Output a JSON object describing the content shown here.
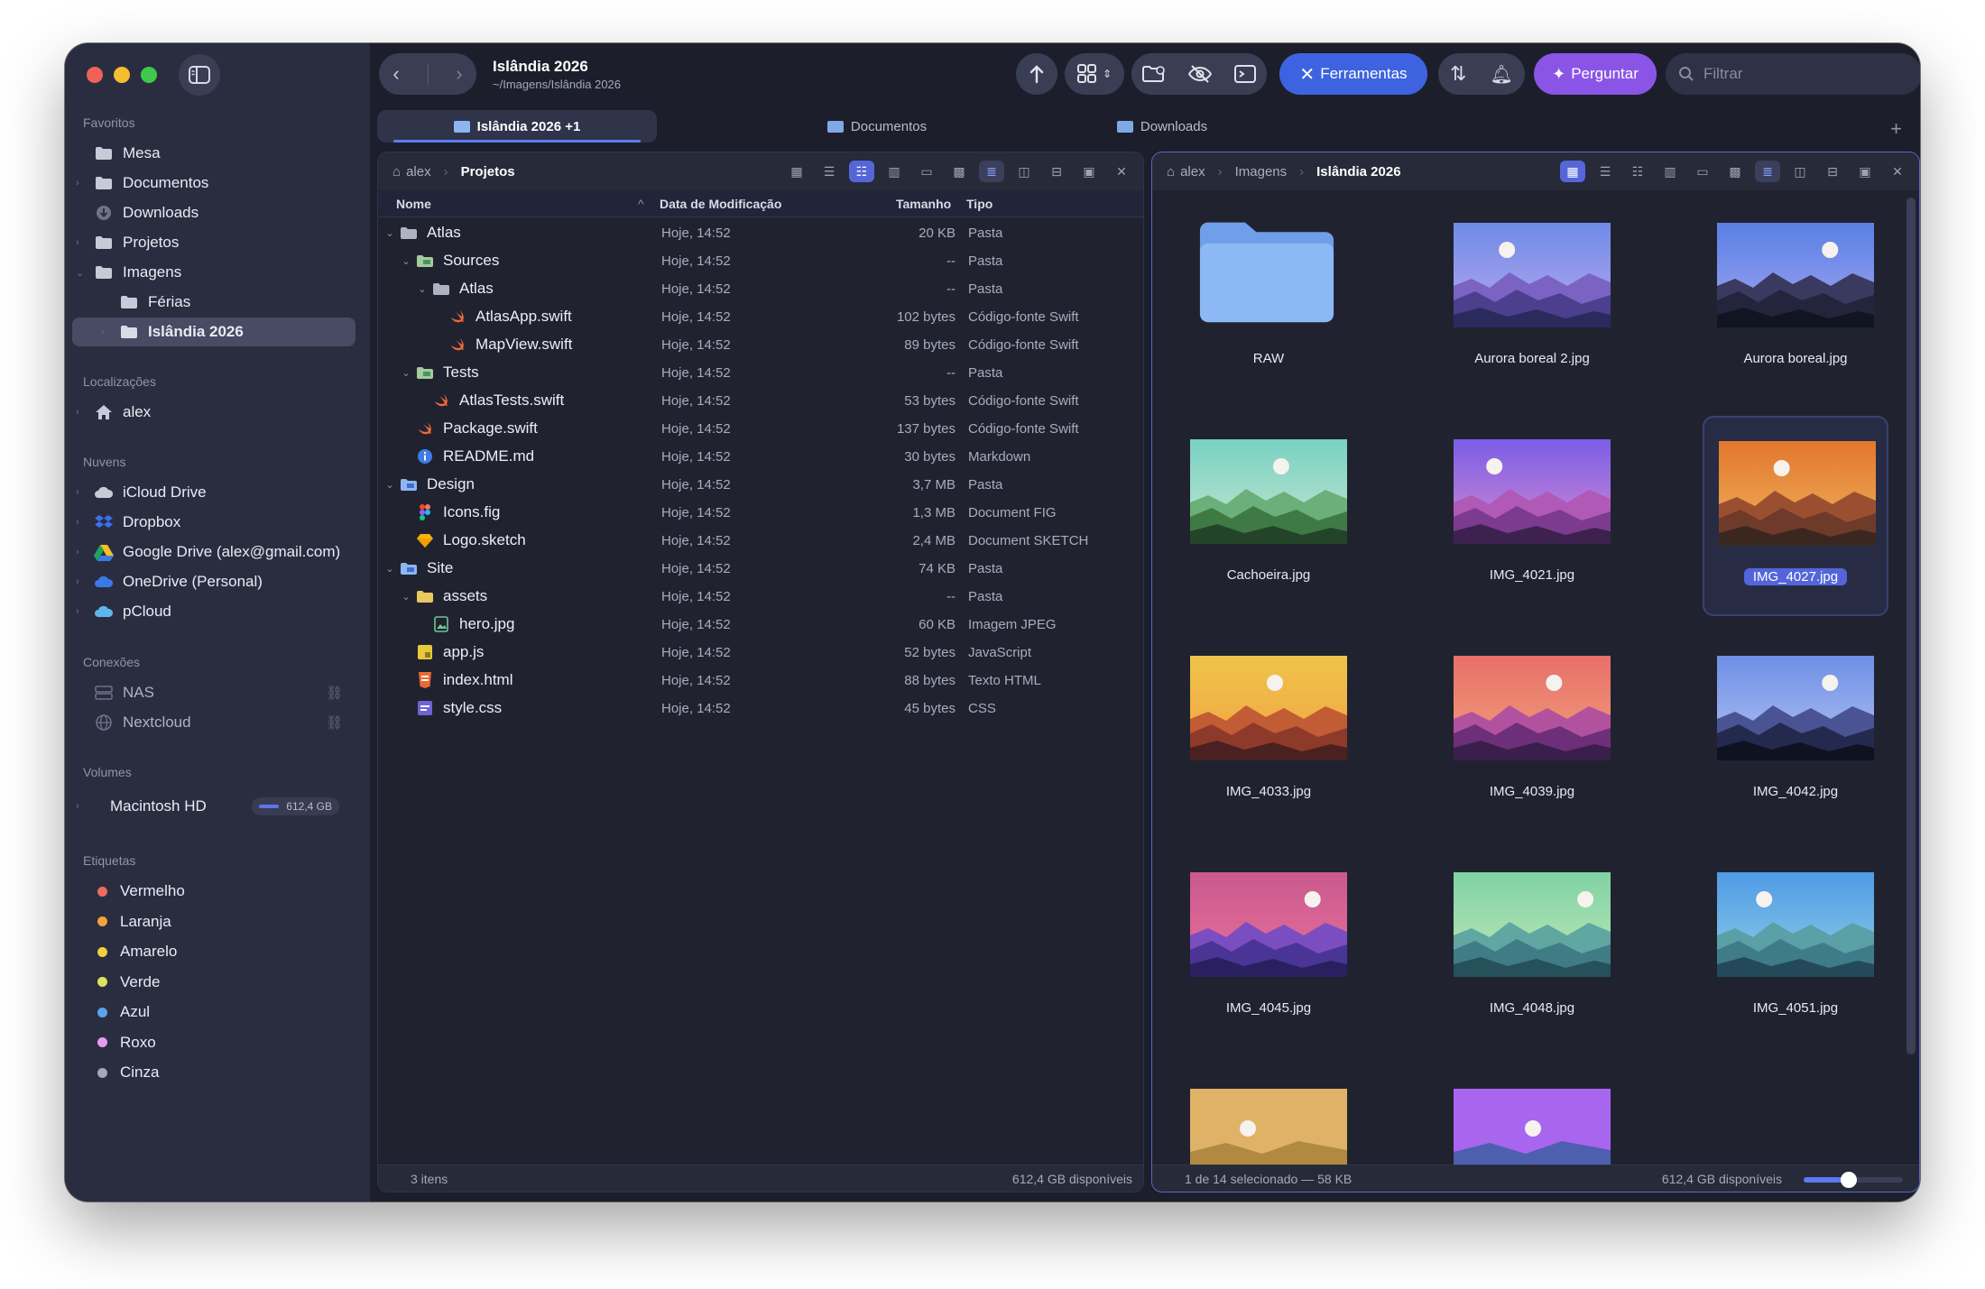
{
  "sidebar": {
    "sections": {
      "favorites": "Favoritos",
      "locations": "Localizações",
      "clouds": "Nuvens",
      "connections": "Conexões",
      "volumes": "Volumes",
      "tags": "Etiquetas"
    },
    "favorites": [
      "Mesa",
      "Documentos",
      "Downloads",
      "Projetos",
      "Imagens",
      "Férias",
      "Islândia 2026"
    ],
    "locations": [
      "alex"
    ],
    "clouds": [
      "iCloud Drive",
      "Dropbox",
      "Google Drive (alex@gmail.com)",
      "OneDrive (Personal)",
      "pCloud"
    ],
    "connections": [
      "NAS",
      "Nextcloud"
    ],
    "volume": {
      "name": "Macintosh HD",
      "free": "612,4 GB"
    },
    "tags": [
      {
        "name": "Vermelho",
        "color": "#ef6a5f"
      },
      {
        "name": "Laranja",
        "color": "#f2a33a"
      },
      {
        "name": "Amarelo",
        "color": "#f2cf3b"
      },
      {
        "name": "Verde",
        "color": "#dbe35b"
      },
      {
        "name": "Azul",
        "color": "#5aa4ee"
      },
      {
        "name": "Roxo",
        "color": "#e49cf0"
      },
      {
        "name": "Cinza",
        "color": "#a4a7b4"
      }
    ]
  },
  "toolbar": {
    "title": "Islândia 2026",
    "path": "~/Imagens/Islândia 2026",
    "tools_label": "Ferramentas",
    "ask_label": "Perguntar",
    "filter_placeholder": "Filtrar"
  },
  "tabs": [
    "Islândia 2026  +1",
    "Documentos",
    "Downloads"
  ],
  "left_pane": {
    "breadcrumb": [
      "alex",
      "Projetos"
    ],
    "columns": {
      "name": "Nome",
      "date": "Data de Modificação",
      "size": "Tamanho",
      "kind": "Tipo"
    },
    "rows": [
      {
        "name": "Atlas",
        "date": "Hoje, 14:52",
        "size": "20 KB",
        "kind": "Pasta"
      },
      {
        "name": "Sources",
        "date": "Hoje, 14:52",
        "size": "--",
        "kind": "Pasta"
      },
      {
        "name": "Atlas",
        "date": "Hoje, 14:52",
        "size": "--",
        "kind": "Pasta"
      },
      {
        "name": "AtlasApp.swift",
        "date": "Hoje, 14:52",
        "size": "102 bytes",
        "kind": "Código-fonte Swift"
      },
      {
        "name": "MapView.swift",
        "date": "Hoje, 14:52",
        "size": "89 bytes",
        "kind": "Código-fonte Swift"
      },
      {
        "name": "Tests",
        "date": "Hoje, 14:52",
        "size": "--",
        "kind": "Pasta"
      },
      {
        "name": "AtlasTests.swift",
        "date": "Hoje, 14:52",
        "size": "53 bytes",
        "kind": "Código-fonte Swift"
      },
      {
        "name": "Package.swift",
        "date": "Hoje, 14:52",
        "size": "137 bytes",
        "kind": "Código-fonte Swift"
      },
      {
        "name": "README.md",
        "date": "Hoje, 14:52",
        "size": "30 bytes",
        "kind": "Markdown"
      },
      {
        "name": "Design",
        "date": "Hoje, 14:52",
        "size": "3,7 MB",
        "kind": "Pasta"
      },
      {
        "name": "Icons.fig",
        "date": "Hoje, 14:52",
        "size": "1,3 MB",
        "kind": "Document FIG"
      },
      {
        "name": "Logo.sketch",
        "date": "Hoje, 14:52",
        "size": "2,4 MB",
        "kind": "Document SKETCH"
      },
      {
        "name": "Site",
        "date": "Hoje, 14:52",
        "size": "74 KB",
        "kind": "Pasta"
      },
      {
        "name": "assets",
        "date": "Hoje, 14:52",
        "size": "--",
        "kind": "Pasta"
      },
      {
        "name": "hero.jpg",
        "date": "Hoje, 14:52",
        "size": "60 KB",
        "kind": "Imagem JPEG"
      },
      {
        "name": "app.js",
        "date": "Hoje, 14:52",
        "size": "52 bytes",
        "kind": "JavaScript"
      },
      {
        "name": "index.html",
        "date": "Hoje, 14:52",
        "size": "88 bytes",
        "kind": "Texto HTML"
      },
      {
        "name": "style.css",
        "date": "Hoje, 14:52",
        "size": "45 bytes",
        "kind": "CSS"
      }
    ],
    "footer_left": "3 itens",
    "footer_right": "612,4 GB disponíveis"
  },
  "right_pane": {
    "breadcrumb": [
      "alex",
      "Imagens",
      "Islândia 2026"
    ],
    "items": [
      "RAW",
      "Aurora boreal 2.jpg",
      "Aurora boreal.jpg",
      "Cachoeira.jpg",
      "IMG_4021.jpg",
      "IMG_4027.jpg",
      "IMG_4033.jpg",
      "IMG_4039.jpg",
      "IMG_4042.jpg",
      "IMG_4045.jpg",
      "IMG_4048.jpg",
      "IMG_4051.jpg"
    ],
    "footer_left": "1 de 14 selecionado — 58 KB",
    "footer_right": "612,4 GB disponíveis",
    "zoom": 0.45
  }
}
